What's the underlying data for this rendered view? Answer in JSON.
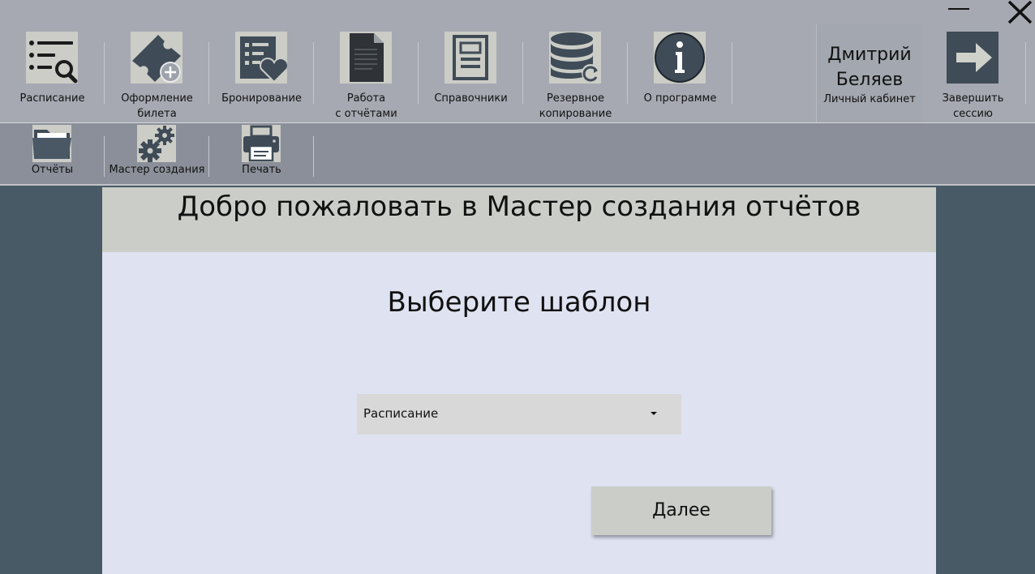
{
  "toolbar": {
    "items": [
      {
        "label": "Расписание",
        "icon": "schedule-search-icon"
      },
      {
        "label": "Оформление\nбилета",
        "icon": "ticket-add-icon"
      },
      {
        "label": "Бронирование",
        "icon": "booking-heart-icon"
      },
      {
        "label": "Работа\nс отчётами",
        "icon": "document-icon"
      },
      {
        "label": "Справочники",
        "icon": "reference-book-icon"
      },
      {
        "label": "Резервное\nкопирование",
        "icon": "database-backup-icon"
      },
      {
        "label": "О программе",
        "icon": "info-icon"
      }
    ],
    "user": {
      "name": "Дмитрий\nБеляев",
      "subtitle": "Личный кабинет"
    },
    "logout": {
      "label": "Завершить\nсессию",
      "icon": "arrow-right-icon"
    }
  },
  "subtoolbar": {
    "items": [
      {
        "label": "Отчёты",
        "icon": "folder-icon"
      },
      {
        "label": "Мастер создания",
        "icon": "gears-icon"
      },
      {
        "label": "Печать",
        "icon": "printer-icon"
      }
    ]
  },
  "wizard": {
    "title": "Добро пожаловать в Мастер создания отчётов",
    "prompt": "Выберите шаблон",
    "template_selected": "Расписание",
    "next_label": "Далее"
  },
  "colors": {
    "ribbon": "#a6a9b2",
    "subribbon": "#8b8f99",
    "background": "#475a66",
    "panel": "#dfe3f1",
    "header": "#cbcec8",
    "icon_dark": "#3f4b57"
  }
}
